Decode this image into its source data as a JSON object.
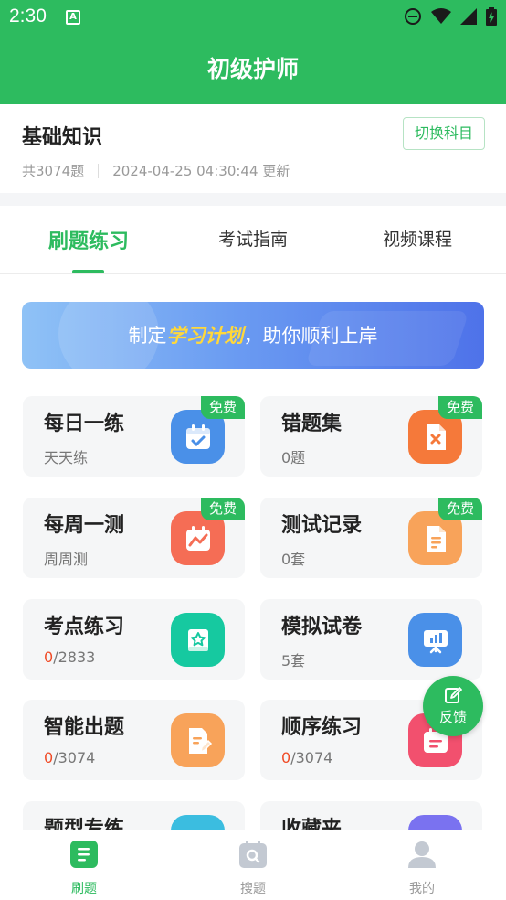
{
  "status_bar": {
    "time": "2:30",
    "app_badge": "A"
  },
  "header": {
    "title": "初级护师"
  },
  "subject": {
    "name": "基础知识",
    "switch_label": "切换科目",
    "question_count": "共3074题",
    "updated": "2024-04-25 04:30:44 更新"
  },
  "tabs": [
    {
      "label": "刷题练习",
      "active": true
    },
    {
      "label": "考试指南",
      "active": false
    },
    {
      "label": "视频课程",
      "active": false
    }
  ],
  "banner": {
    "prefix": "制定",
    "highlight": "学习计划",
    "suffix": "，助你顺利上岸"
  },
  "cards": [
    {
      "title": "每日一练",
      "sub": "天天练",
      "badge": "免费",
      "icon": "calendar-check-icon",
      "color": "#4a90e8"
    },
    {
      "title": "错题集",
      "sub": "0题",
      "badge": "免费",
      "icon": "wrong-file-icon",
      "color": "#f5793a"
    },
    {
      "title": "每周一测",
      "sub": "周周测",
      "badge": "免费",
      "icon": "chart-calendar-icon",
      "color": "#f56d55"
    },
    {
      "title": "测试记录",
      "sub": "0套",
      "badge": "免费",
      "icon": "record-file-icon",
      "color": "#f8a35a"
    },
    {
      "title": "考点练习",
      "sub_hl": "0",
      "sub_rest": "/2833",
      "icon": "star-book-icon",
      "color": "#16c9a0"
    },
    {
      "title": "模拟试卷",
      "sub": "5套",
      "icon": "presentation-icon",
      "color": "#4a90e8"
    },
    {
      "title": "智能出题",
      "sub_hl": "0",
      "sub_rest": "/3074",
      "icon": "edit-file-icon",
      "color": "#f8a35a"
    },
    {
      "title": "顺序练习",
      "sub_hl": "0",
      "sub_rest": "/3074",
      "icon": "list-calendar-icon",
      "color": "#f2506e"
    },
    {
      "title": "题型专练",
      "icon": "type-icon",
      "color": "#3bbde0"
    },
    {
      "title": "收藏夹",
      "icon": "favorite-icon",
      "color": "#7a72f0"
    }
  ],
  "feedback": {
    "label": "反馈"
  },
  "bottom_nav": [
    {
      "label": "刷题",
      "active": true
    },
    {
      "label": "搜题",
      "active": false
    },
    {
      "label": "我的",
      "active": false
    }
  ],
  "colors": {
    "brand": "#2dbb5f",
    "highlight": "#f04b26"
  }
}
